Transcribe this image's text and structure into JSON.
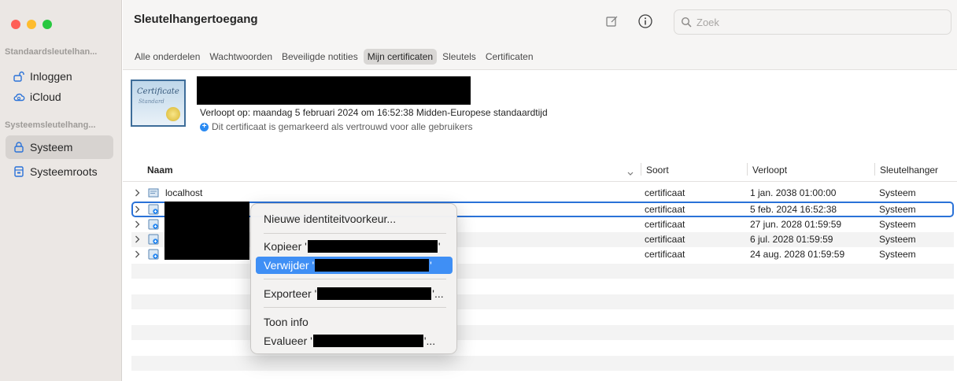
{
  "window": {
    "title": "Sleutelhangertoegang",
    "traffic_lights": [
      "close",
      "minimize",
      "zoom"
    ]
  },
  "sidebar": {
    "sections": [
      {
        "label": "Standaardsleutelhan...",
        "items": [
          {
            "label": "Inloggen",
            "icon": "unlock-icon"
          },
          {
            "label": "iCloud",
            "icon": "cloud-icon"
          }
        ]
      },
      {
        "label": "Systeemsleutelhang...",
        "items": [
          {
            "label": "Systeem",
            "icon": "lock-icon",
            "selected": true
          },
          {
            "label": "Systeemroots",
            "icon": "cabinet-icon"
          }
        ]
      }
    ]
  },
  "toolbar": {
    "compose_icon": "compose-icon",
    "info_icon": "info-icon",
    "search_placeholder": "Zoek"
  },
  "tabs": [
    {
      "label": "Alle onderdelen"
    },
    {
      "label": "Wachtwoorden"
    },
    {
      "label": "Beveiligde notities"
    },
    {
      "label": "Mijn certificaten",
      "active": true
    },
    {
      "label": "Sleutels"
    },
    {
      "label": "Certificaten"
    }
  ],
  "detail": {
    "cert_image_text": "Certificate",
    "cert_image_subtext": "Standard",
    "expires": "Verloopt op: maandag 5 februari 2024 om 16:52:38 Midden-Europese standaardtijd",
    "trust_text": "Dit certificaat is gemarkeerd als vertrouwd voor alle gebruikers"
  },
  "table": {
    "columns": [
      "Naam",
      "Soort",
      "Verloopt",
      "Sleutelhanger"
    ],
    "rows": [
      {
        "name": "localhost",
        "kind": "certificaat",
        "expires": "1 jan. 2038 01:00:00",
        "keychain": "Systeem"
      },
      {
        "name": "",
        "kind": "certificaat",
        "expires": "5 feb. 2024 16:52:38",
        "keychain": "Systeem",
        "selected": true
      },
      {
        "name": "",
        "kind": "certificaat",
        "expires": "27 jun. 2028 01:59:59",
        "keychain": "Systeem"
      },
      {
        "name": "",
        "kind": "certificaat",
        "expires": "6 jul. 2028 01:59:59",
        "keychain": "Systeem"
      },
      {
        "name": "",
        "kind": "certificaat",
        "expires": "24 aug. 2028 01:59:59",
        "keychain": "Systeem"
      }
    ]
  },
  "context_menu": {
    "new_identity": "Nieuwe identiteitvoorkeur...",
    "copy_prefix": "Kopieer '",
    "copy_suffix": "'",
    "delete_prefix": "Verwijder '",
    "delete_suffix": "'",
    "export_prefix": "Exporteer '",
    "export_suffix": "'...",
    "show_info": "Toon info",
    "evaluate_prefix": "Evalueer '",
    "evaluate_suffix": "'...",
    "highlight_color": "#3f8ff5"
  }
}
